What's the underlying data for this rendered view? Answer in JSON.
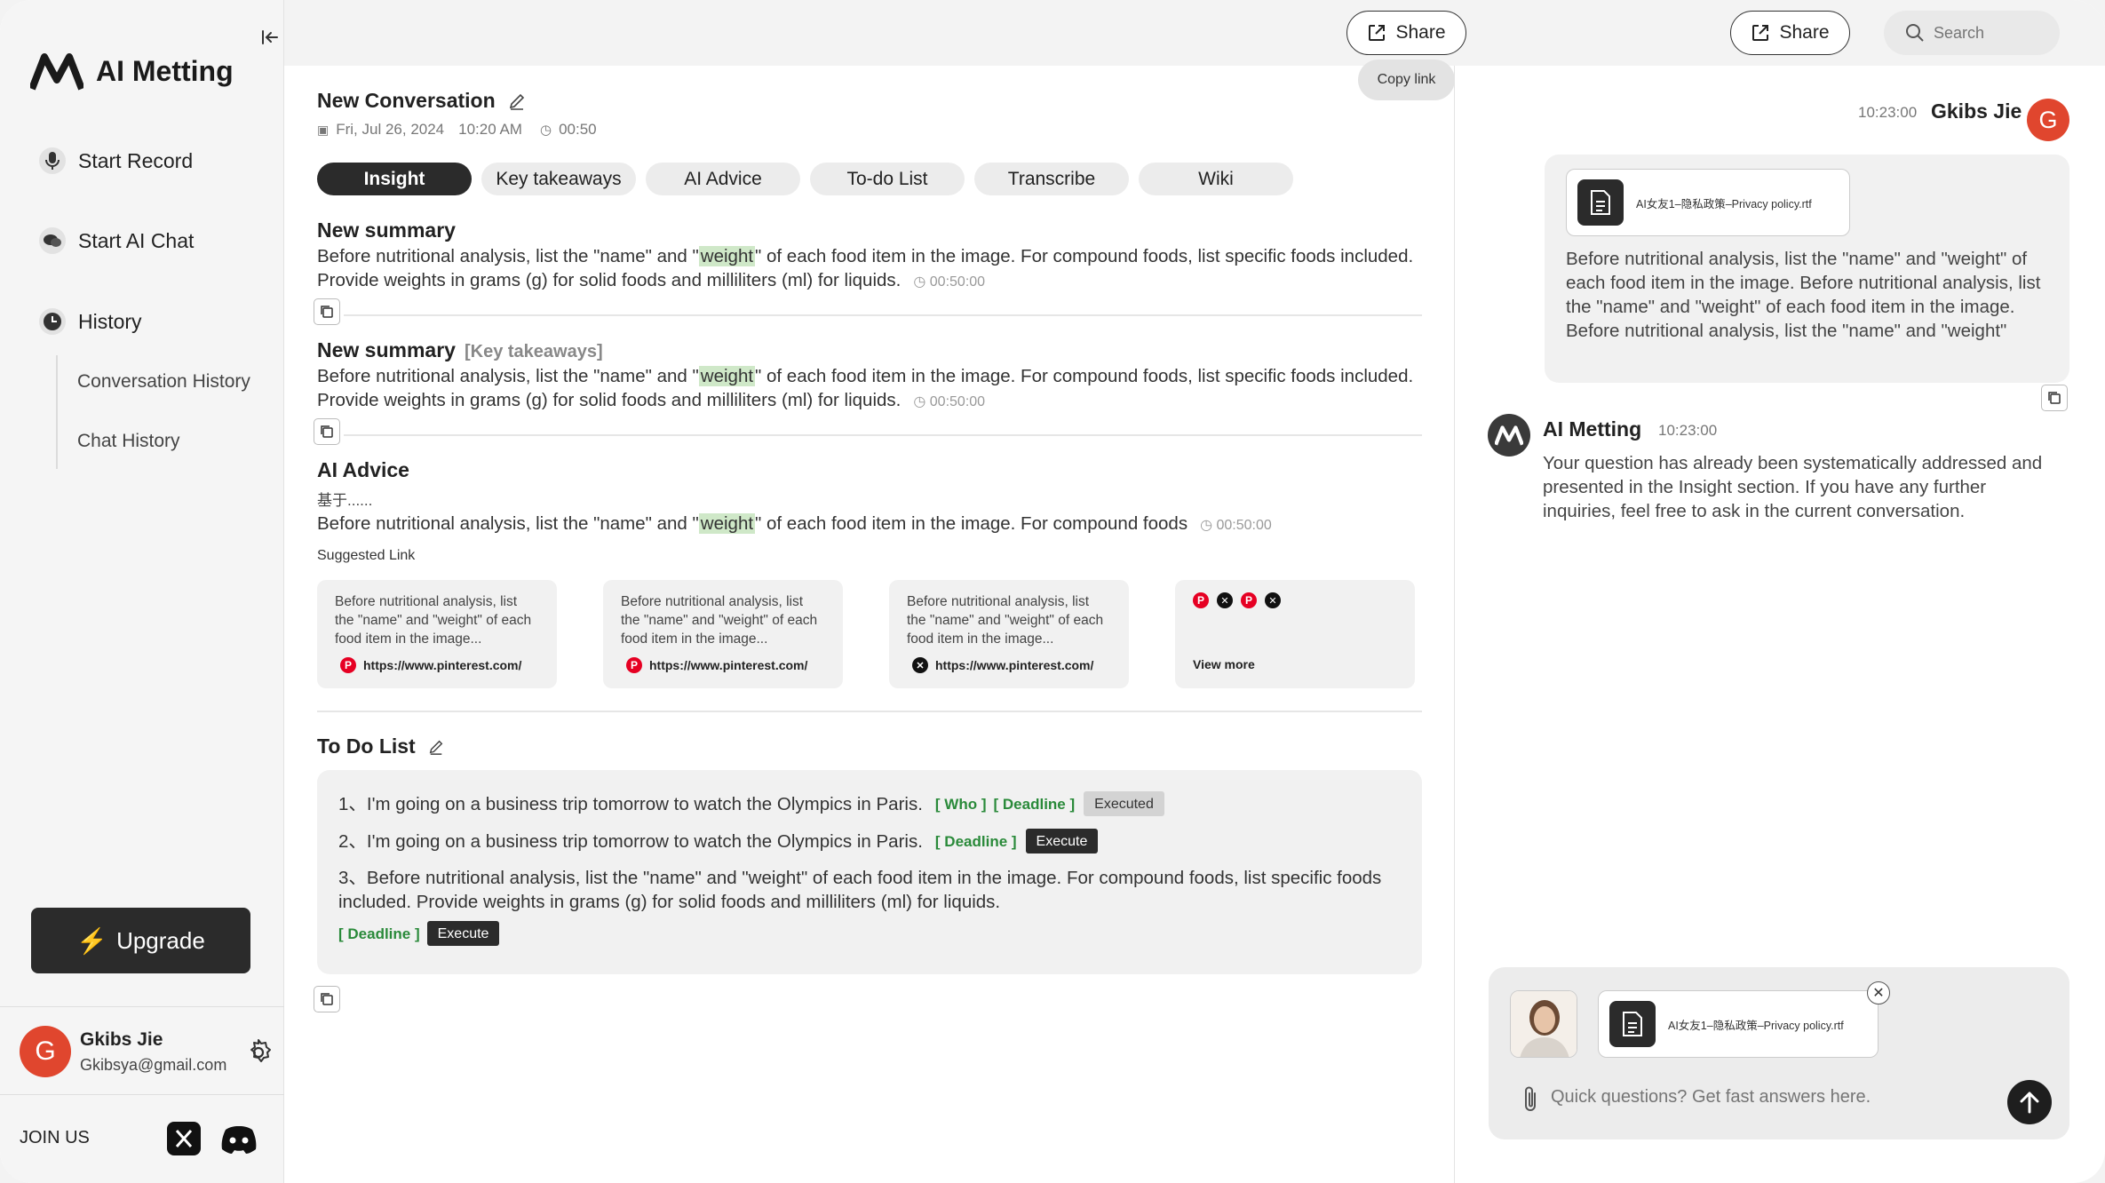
{
  "sidebar": {
    "brand": "AI Metting",
    "items": [
      {
        "label": "Start Record",
        "icon": "microphone-icon"
      },
      {
        "label": "Start AI Chat",
        "icon": "chat-icon"
      },
      {
        "label": "History",
        "icon": "clock-icon"
      }
    ],
    "history_sub": [
      "Conversation History",
      "Chat History"
    ],
    "upgrade_label": "Upgrade",
    "user": {
      "initial": "G",
      "name": "Gkibs Jie",
      "email": "Gkibsya@gmail.com"
    },
    "join_us": "JOIN US"
  },
  "topbar": {
    "share_label": "Share",
    "copy_link": "Copy link",
    "search_placeholder": "Search"
  },
  "conversation": {
    "title": "New Conversation",
    "date": "Fri, Jul 26, 2024",
    "time": "10:20 AM",
    "duration": "00:50",
    "tabs": [
      "Insight",
      "Key takeaways",
      "AI Advice",
      "To-do List",
      "Transcribe",
      "Wiki"
    ],
    "active_tab": "Insight"
  },
  "summary1": {
    "title": "New summary",
    "text_a": "Before nutritional analysis, list the \"name\" and \"",
    "highlight": "weight",
    "text_b": "\" of each food item in the image. For compound foods, list specific foods included. Provide weights in grams (g) for solid foods and milliliters (ml) for liquids.",
    "ts": "00:50:00"
  },
  "summary2": {
    "title": "New summary",
    "tag": "[Key takeaways]",
    "text_a": "Before nutritional analysis, list the \"name\" and \"",
    "highlight": "weight",
    "text_b": "\" of each food item in the image. For compound foods, list specific foods included. Provide weights in grams (g) for solid foods and milliliters (ml) for liquids.",
    "ts": "00:50:00"
  },
  "advice": {
    "title": "AI Advice",
    "prefix": "基于......",
    "text_a": "Before nutritional analysis, list the \"name\" and \"",
    "highlight": "weight",
    "text_b": "\" of each food item in the image. For compound foods",
    "ts": "00:50:00",
    "suggested_label": "Suggested Link",
    "cards": [
      {
        "text": "Before nutritional analysis, list the \"name\" and \"weight\" of each food item in the image...",
        "url": "https://www.pinterest.com/",
        "icon": "pinterest-icon"
      },
      {
        "text": "Before nutritional analysis, list the \"name\" and \"weight\" of each food item in the image...",
        "url": "https://www.pinterest.com/",
        "icon": "pinterest-icon"
      },
      {
        "text": "Before nutritional analysis, list the \"name\" and \"weight\" of each food item in the image...",
        "url": "https://www.pinterest.com/",
        "icon": "x-icon"
      }
    ],
    "view_more": "View more"
  },
  "todo": {
    "title": "To Do List",
    "items": [
      {
        "num": "1、",
        "text": "I'm going on a business trip tomorrow to watch the Olympics in Paris.",
        "who": "[ Who ]",
        "deadline": "[ Deadline ]",
        "status": "Executed"
      },
      {
        "num": "2、",
        "text": "I'm going on a business trip tomorrow to watch the Olympics in Paris.",
        "deadline": "[ Deadline ]",
        "status": "Execute"
      },
      {
        "num": "3、",
        "text": "Before nutritional analysis, list the \"name\" and \"weight\" of each food item in the image. For compound foods, list specific foods included. Provide weights in grams (g) for solid foods and milliliters (ml) for liquids.",
        "deadline": "[ Deadline ]",
        "status": "Execute"
      }
    ]
  },
  "chat": {
    "user_time": "10:23:00",
    "user_name": "Gkibs Jie",
    "user_initial": "G",
    "file_name": "AI女友1–隐私政策–Privacy policy.rtf",
    "user_message": "Before nutritional analysis, list the \"name\" and \"weight\" of each food item in the image. Before nutritional analysis, list the \"name\" and \"weight\" of each food item in the image. Before nutritional analysis, list the \"name\" and \"weight\"",
    "ai_name": "AI Metting",
    "ai_time": "10:23:00",
    "ai_message": "Your question has already been systematically addressed and presented in the Insight section. If you have any further inquiries, feel free to ask in the current conversation.",
    "composer_file": "AI女友1–隐私政策–Privacy policy.rtf",
    "composer_placeholder": "Quick questions? Get fast answers here."
  }
}
